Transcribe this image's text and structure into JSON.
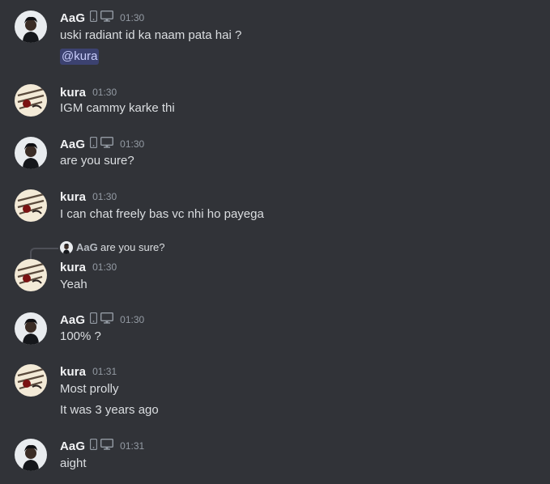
{
  "messages": [
    {
      "author": "AaG",
      "time": "01:30",
      "lines": [
        "uski radiant id ka naam pata hai ?"
      ],
      "mention": "@kura"
    },
    {
      "author": "kura",
      "time": "01:30",
      "lines": [
        "IGM cammy karke thi"
      ]
    },
    {
      "author": "AaG",
      "time": "01:30",
      "lines": [
        "are you sure?"
      ]
    },
    {
      "author": "kura",
      "time": "01:30",
      "lines": [
        "I can chat freely bas vc nhi ho payega"
      ]
    },
    {
      "author": "kura",
      "time": "01:30",
      "lines": [
        "Yeah"
      ],
      "reply": {
        "author": "AaG",
        "text": "are you sure?"
      }
    },
    {
      "author": "AaG",
      "time": "01:30",
      "lines": [
        "100% ?"
      ]
    },
    {
      "author": "kura",
      "time": "01:31",
      "lines": [
        "Most prolly",
        "It was 3 years ago"
      ]
    },
    {
      "author": "AaG",
      "time": "01:31",
      "lines": [
        "aight"
      ]
    }
  ],
  "icons": {
    "device_mobile": "mobile-phone-icon",
    "device_desktop": "desktop-monitor-icon"
  },
  "colors": {
    "background": "#313338",
    "username": "#f2f3f5",
    "timestamp": "#949ba4",
    "message_text": "#dbdee1",
    "mention_bg": "#3c4270",
    "mention_text": "#c9cdfb"
  }
}
